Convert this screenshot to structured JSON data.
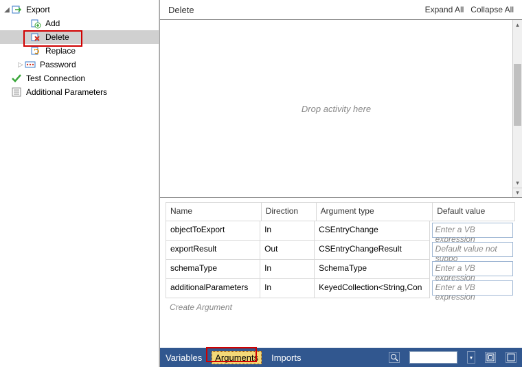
{
  "tree": {
    "export": {
      "label": "Export",
      "expanded": true
    },
    "add": {
      "label": "Add"
    },
    "del": {
      "label": "Delete",
      "selected": true,
      "highlighted": true
    },
    "replace": {
      "label": "Replace"
    },
    "password": {
      "label": "Password",
      "expanded": false
    },
    "test_connection": {
      "label": "Test Connection"
    },
    "additional_parameters": {
      "label": "Additional Parameters"
    }
  },
  "header": {
    "title": "Delete",
    "expand_all": "Expand All",
    "collapse_all": "Collapse All"
  },
  "canvas": {
    "drop_hint": "Drop activity here"
  },
  "grid": {
    "headers": {
      "name": "Name",
      "direction": "Direction",
      "type": "Argument type",
      "def": "Default value"
    },
    "rows": [
      {
        "name": "objectToExport",
        "direction": "In",
        "type": "CSEntryChange",
        "def": "Enter a VB expression"
      },
      {
        "name": "exportResult",
        "direction": "Out",
        "type": "CSEntryChangeResult",
        "def": "Default value not suppo"
      },
      {
        "name": "schemaType",
        "direction": "In",
        "type": "SchemaType",
        "def": "Enter a VB expression"
      },
      {
        "name": "additionalParameters",
        "direction": "In",
        "type": "KeyedCollection<String,Con",
        "def": "Enter a VB expression"
      }
    ],
    "create": "Create Argument"
  },
  "bottombar": {
    "variables": "Variables",
    "arguments": "Arguments",
    "imports": "Imports"
  }
}
